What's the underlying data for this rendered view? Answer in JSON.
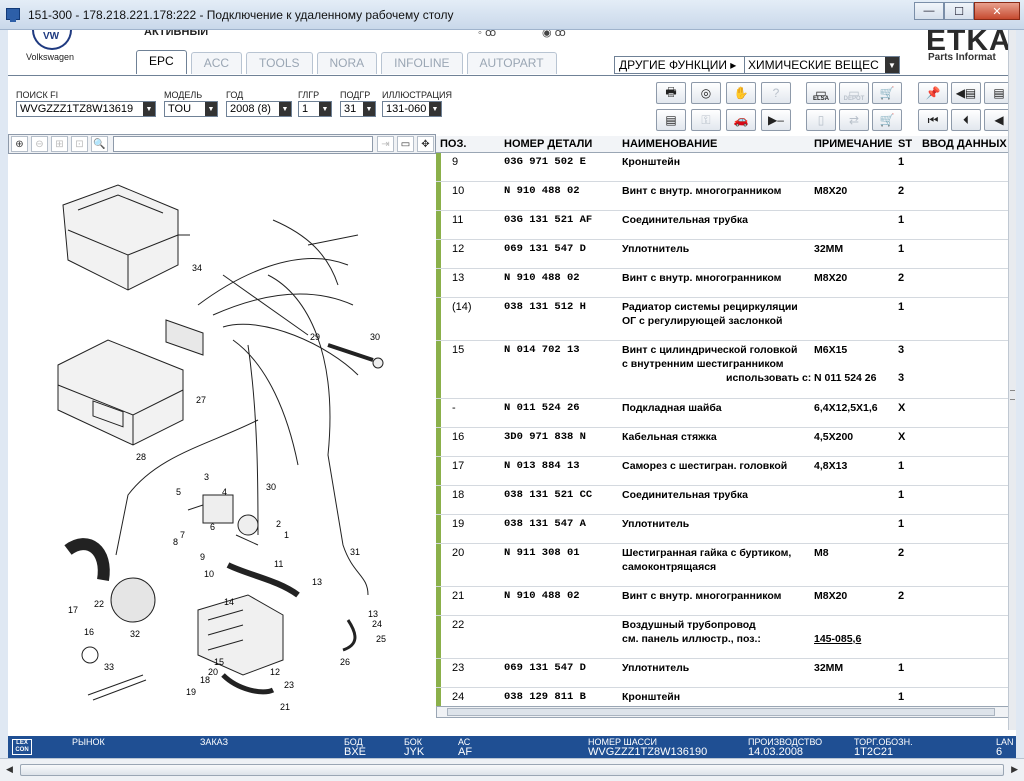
{
  "window": {
    "title": "151-300 - 178.218.221.178:222 - Подключение к удаленному рабочему столу"
  },
  "header": {
    "brand": "Volkswagen",
    "active_label": "АКТИВНЫЙ",
    "etka": "ETKA",
    "etka_sub": "Parts Informat",
    "tabs": [
      "EPC",
      "ACC",
      "TOOLS",
      "NORA",
      "INFOLINE",
      "AUTOPART"
    ],
    "other_functions_label": "ДРУГИЕ ФУНКЦИИ ▸",
    "other_functions_value": "ХИМИЧЕСКИЕ ВЕЩЕС"
  },
  "filters": {
    "search_label": "ПОИСК FI",
    "search_value": "WVGZZZ1TZ8W13619",
    "model_label": "МОДЕЛЬ",
    "model_value": "TOU",
    "year_label": "ГОД",
    "year_value": "2008 (8)",
    "glgr_label": "ГЛГР",
    "glgr_value": "1",
    "podgr_label": "ПОДГР",
    "podgr_value": "31",
    "illus_label": "ИЛЛЮСТРАЦИЯ",
    "illus_value": "131-060"
  },
  "toolbar": {
    "elsa": "ELSA",
    "depot": "DEPOT"
  },
  "table": {
    "headers": {
      "pos": "ПОЗ.",
      "part": "НОМЕР ДЕТАЛИ",
      "name": "НАИМЕНОВАНИЕ",
      "note": "ПРИМЕЧАНИЕ",
      "st": "ST",
      "input": "ВВОД ДАННЫХ"
    },
    "rows": [
      {
        "pos": "9",
        "part": "03G  971  502  E",
        "name": "Кронштейн",
        "note": "",
        "st": "1"
      },
      {
        "pos": "10",
        "part": "N    910  488  02",
        "name": "Винт с внутр. многогранником",
        "note": "M8X20",
        "st": "2"
      },
      {
        "pos": "11",
        "part": "03G  131  521  AF",
        "name": "Соединительная трубка",
        "note": "",
        "st": "1"
      },
      {
        "pos": "12",
        "part": "069  131  547  D",
        "name": "Уплотнитель",
        "note": "32MM",
        "st": "1"
      },
      {
        "pos": "13",
        "part": "N    910  488  02",
        "name": "Винт с внутр. многогранником",
        "note": "M8X20",
        "st": "2"
      },
      {
        "pos": "(14)",
        "part": "038  131  512  H",
        "name": "Радиатор системы рециркуляции",
        "name2": "ОГ с регулирующей заслонкой",
        "note": "",
        "st": "1"
      },
      {
        "pos": "15",
        "part": "N    014  702  13",
        "name": "Винт с цилиндрической головкой",
        "name2": "с внутренним шестигранником",
        "name3": "использовать с:",
        "note": "M6X15",
        "note3": "N  011 524 26",
        "st": "3",
        "st3": "3"
      },
      {
        "pos": "-",
        "part": "N    011  524  26",
        "name": "Подкладная шайба",
        "note": "6,4X12,5X1,6",
        "st": "X"
      },
      {
        "pos": "16",
        "part": "3D0  971  838  N",
        "name": "Кабельная стяжка",
        "note": "4,5X200",
        "st": "X"
      },
      {
        "pos": "17",
        "part": "N    013  884  13",
        "name": "Саморез с шестигран. головкой",
        "note": "4,8X13",
        "st": "1"
      },
      {
        "pos": "18",
        "part": "038  131  521  CC",
        "name": "Соединительная трубка",
        "note": "",
        "st": "1"
      },
      {
        "pos": "19",
        "part": "038  131  547  A",
        "name": "Уплотнитель",
        "note": "",
        "st": "1"
      },
      {
        "pos": "20",
        "part": "N    911  308  01",
        "name": "Шестигранная гайка с буртиком,",
        "name2": "самоконтрящаяся",
        "note": "M8",
        "st": "2"
      },
      {
        "pos": "21",
        "part": "N    910  488  02",
        "name": "Винт с внутр. многогранником",
        "note": "M8X20",
        "st": "2"
      },
      {
        "pos": "22",
        "part": "",
        "name": "Воздушный трубопровод",
        "name2": "см. панель иллюстр., поз.:",
        "note": "",
        "note2": "145-085,6",
        "st": ""
      },
      {
        "pos": "23",
        "part": "069  131  547  D",
        "name": "Уплотнитель",
        "note": "32MM",
        "st": "1"
      },
      {
        "pos": "24",
        "part": "038  129  811  B",
        "name": "Кронштейн",
        "note": "",
        "st": "1"
      }
    ]
  },
  "diagram_labels": [
    "34",
    "29",
    "30",
    "27",
    "28",
    "3",
    "5",
    "4",
    "30",
    "6",
    "2",
    "1",
    "8",
    "7",
    "9",
    "10",
    "11",
    "13",
    "31",
    "22",
    "17",
    "32",
    "14",
    "13",
    "24",
    "25",
    "16",
    "15",
    "20",
    "26",
    "18",
    "23",
    "19",
    "21",
    "12",
    "33"
  ],
  "status": {
    "lex": "LEX CON",
    "market_label": "РЫНОК",
    "order_label": "ЗАКАЗ",
    "engine_label": "БОД",
    "engine_value": "BXE",
    "box_label": "БОК",
    "box_value": "JYK",
    "ac_label": "АС",
    "ac_value": "AF",
    "chassis_label": "НОМЕР ШАССИ",
    "chassis_value": "WVGZZZ1TZ8W136190",
    "prod_label": "ПРОИЗВОДСТВО",
    "prod_value": "14.03.2008",
    "trade_label": "ТОРГ.ОБОЗН.",
    "trade_value": "1T2C21",
    "lang_label": "LAN",
    "lang_value": "6"
  },
  "colors": {
    "accent_bar": "#8bb04a",
    "status_bg": "#1f4f93"
  }
}
